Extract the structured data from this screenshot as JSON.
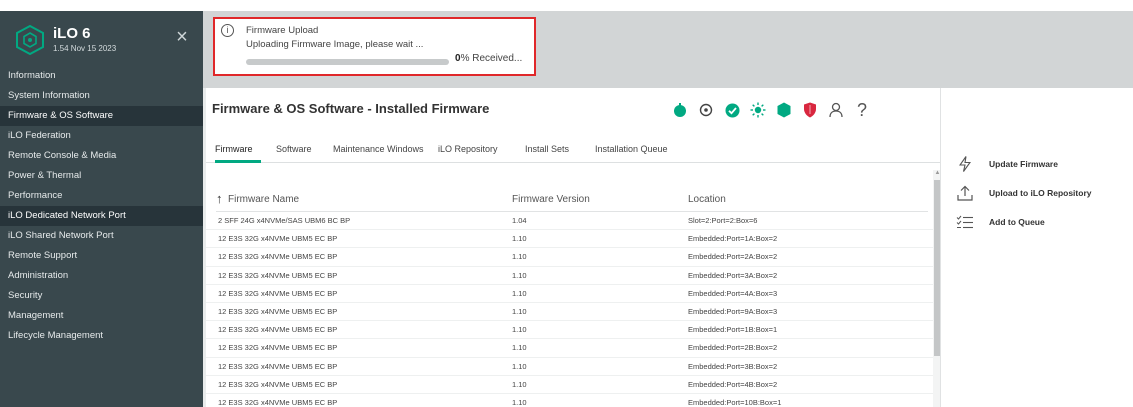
{
  "sidebar": {
    "title": "iLO 6",
    "version": "1.54 Nov 15 2023",
    "items": [
      {
        "label": "Information",
        "active": false
      },
      {
        "label": "System Information",
        "active": false
      },
      {
        "label": "Firmware & OS Software",
        "active": true
      },
      {
        "label": "iLO Federation",
        "active": false
      },
      {
        "label": "Remote Console & Media",
        "active": false
      },
      {
        "label": "Power & Thermal",
        "active": false
      },
      {
        "label": "Performance",
        "active": false
      },
      {
        "label": "iLO Dedicated Network Port",
        "active": true
      },
      {
        "label": "iLO Shared Network Port",
        "active": false
      },
      {
        "label": "Remote Support",
        "active": false
      },
      {
        "label": "Administration",
        "active": false
      },
      {
        "label": "Security",
        "active": false
      },
      {
        "label": "Management",
        "active": false
      },
      {
        "label": "Lifecycle Management",
        "active": false
      }
    ]
  },
  "notification": {
    "title": "Firmware Upload",
    "message": "Uploading Firmware Image, please wait ...",
    "percent": "0",
    "percent_suffix": "% Received...",
    "progress": 0
  },
  "page": {
    "title": "Firmware & OS Software - Installed Firmware"
  },
  "header_icons": [
    "power-icon",
    "target-icon",
    "check-status-icon",
    "sun-icon",
    "hexagon-status-icon",
    "shield-icon",
    "user-icon",
    "help-icon"
  ],
  "tabs": [
    {
      "label": "Firmware",
      "active": true
    },
    {
      "label": "Software",
      "active": false
    },
    {
      "label": "Maintenance Windows",
      "active": false
    },
    {
      "label": "iLO Repository",
      "active": false
    },
    {
      "label": "Install Sets",
      "active": false
    },
    {
      "label": "Installation Queue",
      "active": false
    }
  ],
  "table": {
    "headers": [
      "Firmware Name",
      "Firmware Version",
      "Location"
    ],
    "rows": [
      [
        "2 SFF 24G x4NVMe/SAS UBM6 BC BP",
        "1.04",
        "Slot=2:Port=2:Box=6"
      ],
      [
        "12 E3S 32G x4NVMe UBM5 EC BP",
        "1.10",
        "Embedded:Port=1A:Box=2"
      ],
      [
        "12 E3S 32G x4NVMe UBM5 EC BP",
        "1.10",
        "Embedded:Port=2A:Box=2"
      ],
      [
        "12 E3S 32G x4NVMe UBM5 EC BP",
        "1.10",
        "Embedded:Port=3A:Box=2"
      ],
      [
        "12 E3S 32G x4NVMe UBM5 EC BP",
        "1.10",
        "Embedded:Port=4A:Box=3"
      ],
      [
        "12 E3S 32G x4NVMe UBM5 EC BP",
        "1.10",
        "Embedded:Port=9A:Box=3"
      ],
      [
        "12 E3S 32G x4NVMe UBM5 EC BP",
        "1.10",
        "Embedded:Port=1B:Box=1"
      ],
      [
        "12 E3S 32G x4NVMe UBM5 EC BP",
        "1.10",
        "Embedded:Port=2B:Box=2"
      ],
      [
        "12 E3S 32G x4NVMe UBM5 EC BP",
        "1.10",
        "Embedded:Port=3B:Box=2"
      ],
      [
        "12 E3S 32G x4NVMe UBM5 EC BP",
        "1.10",
        "Embedded:Port=4B:Box=2"
      ],
      [
        "12 E3S 32G x4NVMe UBM5 EC BP",
        "1.10",
        "Embedded:Port=10B:Box=1"
      ]
    ]
  },
  "actions": [
    {
      "label": "Update Firmware",
      "icon": "flash-icon"
    },
    {
      "label": "Upload to iLO Repository",
      "icon": "upload-icon"
    },
    {
      "label": "Add to Queue",
      "icon": "queue-icon"
    }
  ],
  "colors": {
    "accent": "#01a982",
    "sidebar_bg": "#39484d",
    "sidebar_active": "#27343a",
    "alert_border": "#e0282a",
    "status_green": "#01a982",
    "status_warning": "#d9273f"
  }
}
